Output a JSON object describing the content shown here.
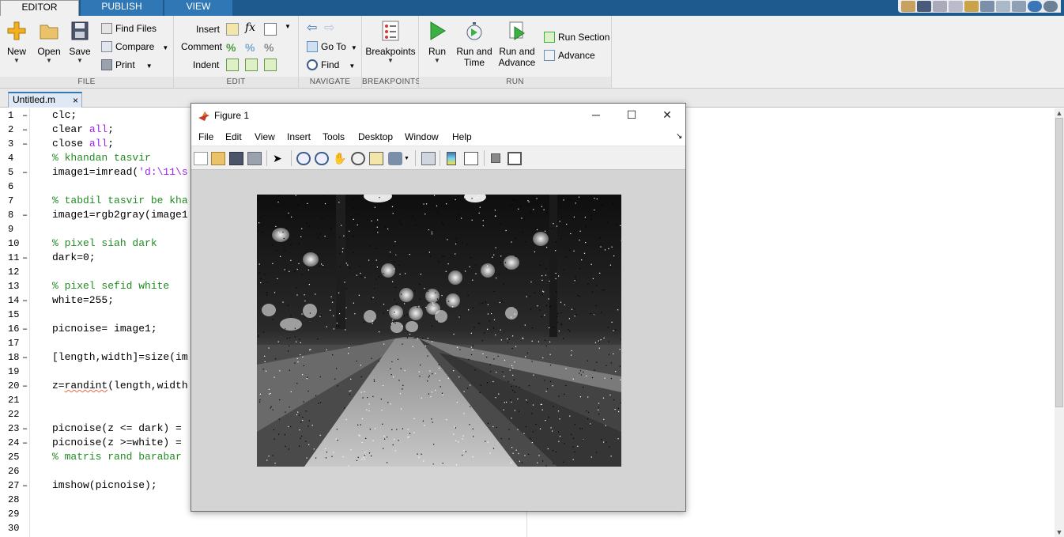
{
  "ribbon_tabs": [
    {
      "label": "EDITOR",
      "active": true
    },
    {
      "label": "PUBLISH",
      "active": false
    },
    {
      "label": "VIEW",
      "active": false
    }
  ],
  "ribbon": {
    "file": {
      "label": "FILE",
      "new": "New",
      "open": "Open",
      "save": "Save",
      "find_files": "Find Files",
      "compare": "Compare",
      "print": "Print"
    },
    "edit": {
      "label": "EDIT",
      "insert": "Insert",
      "comment": "Comment",
      "indent": "Indent",
      "fx": "fx"
    },
    "navigate": {
      "label": "NAVIGATE",
      "go_to": "Go To",
      "find": "Find"
    },
    "breakpoints": {
      "label": "BREAKPOINTS",
      "breakpoints": "Breakpoints"
    },
    "run": {
      "label": "RUN",
      "run": "Run",
      "run_and_time_1": "Run and",
      "run_and_time_2": "Time",
      "run_and_advance_1": "Run and",
      "run_and_advance_2": "Advance",
      "run_section": "Run Section",
      "advance": "Advance"
    }
  },
  "document_tab": {
    "name": "Untitled.m",
    "close": "×"
  },
  "code_lines": [
    {
      "n": "1",
      "dash": "–",
      "parts": [
        {
          "t": "clc;",
          "c": ""
        }
      ]
    },
    {
      "n": "2",
      "dash": "–",
      "parts": [
        {
          "t": "clear ",
          "c": ""
        },
        {
          "t": "all",
          "c": "kw"
        },
        {
          "t": ";",
          "c": ""
        }
      ]
    },
    {
      "n": "3",
      "dash": "–",
      "parts": [
        {
          "t": "close ",
          "c": ""
        },
        {
          "t": "all",
          "c": "kw"
        },
        {
          "t": ";",
          "c": ""
        }
      ]
    },
    {
      "n": "4",
      "dash": "",
      "parts": [
        {
          "t": "% khandan tasvir",
          "c": "cm"
        }
      ]
    },
    {
      "n": "5",
      "dash": "–",
      "parts": [
        {
          "t": "image1=imread(",
          "c": ""
        },
        {
          "t": "'d:\\11\\s",
          "c": "str"
        }
      ]
    },
    {
      "n": "6",
      "dash": "",
      "parts": []
    },
    {
      "n": "7",
      "dash": "",
      "parts": [
        {
          "t": "% tabdil tasvir be kha",
          "c": "cm"
        }
      ]
    },
    {
      "n": "8",
      "dash": "–",
      "parts": [
        {
          "t": "image1=rgb2gray(image1",
          "c": ""
        }
      ]
    },
    {
      "n": "9",
      "dash": "",
      "parts": []
    },
    {
      "n": "10",
      "dash": "",
      "parts": [
        {
          "t": "% pixel siah dark",
          "c": "cm"
        }
      ]
    },
    {
      "n": "11",
      "dash": "–",
      "parts": [
        {
          "t": "dark=0;",
          "c": ""
        }
      ]
    },
    {
      "n": "12",
      "dash": "",
      "parts": []
    },
    {
      "n": "13",
      "dash": "",
      "parts": [
        {
          "t": "% pixel sefid white",
          "c": "cm"
        }
      ]
    },
    {
      "n": "14",
      "dash": "–",
      "parts": [
        {
          "t": "white=255;",
          "c": ""
        }
      ]
    },
    {
      "n": "15",
      "dash": "",
      "parts": []
    },
    {
      "n": "16",
      "dash": "–",
      "parts": [
        {
          "t": "picnoise= image1;",
          "c": ""
        }
      ]
    },
    {
      "n": "17",
      "dash": "",
      "parts": []
    },
    {
      "n": "18",
      "dash": "–",
      "parts": [
        {
          "t": "[length,width]=size(im",
          "c": ""
        }
      ]
    },
    {
      "n": "19",
      "dash": "",
      "parts": []
    },
    {
      "n": "20",
      "dash": "–",
      "parts": [
        {
          "t": "z=",
          "c": ""
        },
        {
          "t": "randint",
          "c": "squig"
        },
        {
          "t": "(length,width",
          "c": ""
        }
      ]
    },
    {
      "n": "21",
      "dash": "",
      "parts": []
    },
    {
      "n": "22",
      "dash": "",
      "parts": []
    },
    {
      "n": "23",
      "dash": "–",
      "parts": [
        {
          "t": "picnoise(z <= dark) =",
          "c": ""
        }
      ]
    },
    {
      "n": "24",
      "dash": "–",
      "parts": [
        {
          "t": "picnoise(z >=white) =",
          "c": ""
        }
      ]
    },
    {
      "n": "25",
      "dash": "",
      "parts": [
        {
          "t": "% matris rand barabar",
          "c": "cm"
        }
      ]
    },
    {
      "n": "26",
      "dash": "",
      "parts": []
    },
    {
      "n": "27",
      "dash": "–",
      "parts": [
        {
          "t": "imshow(picnoise);",
          "c": ""
        }
      ]
    },
    {
      "n": "28",
      "dash": "",
      "parts": []
    },
    {
      "n": "29",
      "dash": "",
      "parts": []
    },
    {
      "n": "30",
      "dash": "",
      "parts": []
    }
  ],
  "figure": {
    "title": "Figure 1",
    "minimize": "─",
    "maximize": "☐",
    "close": "✕",
    "menu": [
      "File",
      "Edit",
      "View",
      "Insert",
      "Tools",
      "Desktop",
      "Window",
      "Help"
    ],
    "dock_arrow": "↘",
    "image_description_icon": "noisy-grayscale-road-image"
  },
  "colors": {
    "accent": "#1e5a8e",
    "tab_blue": "#2f77b5",
    "comment": "#228b22",
    "keyword": "#a020f0"
  }
}
